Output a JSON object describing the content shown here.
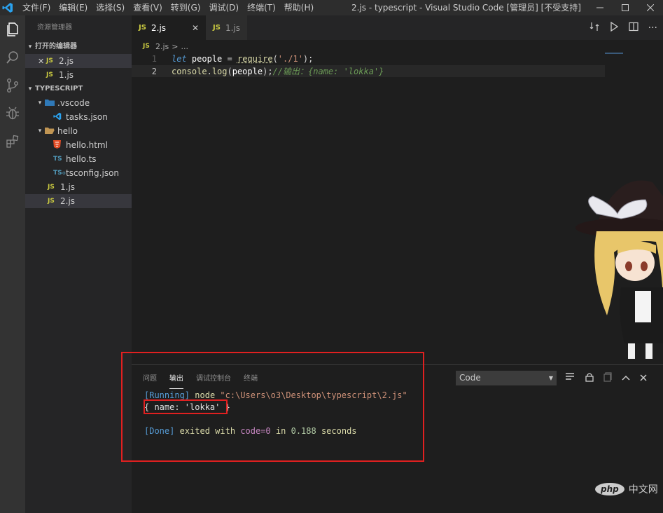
{
  "titlebar": {
    "menu": [
      "文件(F)",
      "编辑(E)",
      "选择(S)",
      "查看(V)",
      "转到(G)",
      "调试(D)",
      "终端(T)",
      "帮助(H)"
    ],
    "title": "2.js - typescript - Visual Studio Code [管理员] [不受支持]"
  },
  "sidebar": {
    "title": "资源管理器",
    "open_editors_label": "打开的编辑器",
    "open_editors": [
      {
        "name": "2.js",
        "icon": "JS"
      },
      {
        "name": "1.js",
        "icon": "JS"
      }
    ],
    "workspace_label": "TYPESCRIPT",
    "tree": {
      "vscode_folder": ".vscode",
      "tasks": "tasks.json",
      "hello_folder": "hello",
      "hello_html": "hello.html",
      "hello_ts": "hello.ts",
      "tsconfig": "tsconfig.json",
      "file1": "1.js",
      "file2": "2.js"
    },
    "icon_labels": {
      "js": "JS",
      "ts": "TS"
    }
  },
  "tabs": [
    {
      "label": "2.js",
      "icon": "JS",
      "active": true
    },
    {
      "label": "1.js",
      "icon": "JS",
      "active": false
    }
  ],
  "breadcrumb": {
    "file": "2.js",
    "sep": ">",
    "more": "..."
  },
  "editor": {
    "lines": [
      {
        "num": "1",
        "kw": "let",
        "var": "people",
        "op": "=",
        "fn": "require",
        "str": "'./1'",
        "tail": ");"
      },
      {
        "num": "2",
        "obj": "console",
        "method": "log",
        "arg": "people",
        "tail": ");",
        "comment": "//输出：{name: 'lokka'}"
      }
    ]
  },
  "panel": {
    "tabs": [
      "问题",
      "输出",
      "调试控制台",
      "终端"
    ],
    "active_tab": "输出",
    "select_value": "Code",
    "output": {
      "running_tag": "[Running]",
      "cmd": "node",
      "path": "\"c:\\Users\\o3\\Desktop\\typescript\\2.js\"",
      "result": "{ name: 'lokka' }",
      "done_tag": "[Done]",
      "exited": "exited with",
      "code": "code=0",
      "in": "in",
      "time": "0.188",
      "seconds": "seconds"
    }
  },
  "watermark": {
    "logo": "php",
    "text": "中文网"
  }
}
